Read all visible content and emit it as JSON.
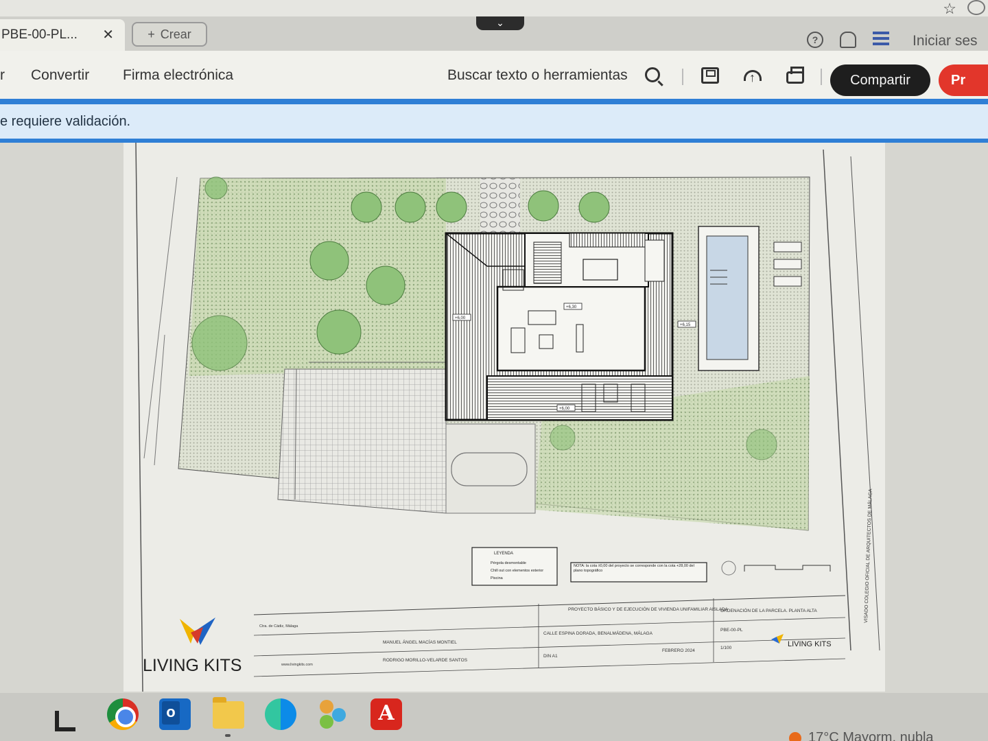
{
  "browser": {
    "tab_title": "PBE-00-PL...",
    "tab_close": "✕",
    "create_icon": "+",
    "create_label": "Crear",
    "collapse_icon": "⌄",
    "help_icon": "?",
    "signin_label": "Iniciar ses"
  },
  "toolbar": {
    "left_cut": "r",
    "convert_label": "Convertir",
    "esign_label": "Firma electrónica",
    "search_label": "Buscar texto o herramientas",
    "share_label": "Compartir",
    "red_button_label": "Pr"
  },
  "banner": {
    "text": "e requiere validación."
  },
  "document": {
    "legend_title": "LEYENDA",
    "legend_items": [
      "Pérgola desmontable",
      "Chill out con elementos exterior",
      "Piscina"
    ],
    "note": "NOTA: la cota ±0,00 del proyecto se corresponde con la cota +28,00 del plano topográfico",
    "level_tags": [
      "+6,00",
      "+6,30",
      "+6,15",
      "+6,00"
    ],
    "title_block": {
      "project": "PROYECTO BÁSICO Y DE EJECUCIÓN DE VIVIENDA UNIFAMILIAR AISLADA",
      "sheet_title": "ORDENACIÓN DE LA PARCELA. PLANTA ALTA",
      "location": "CALLE ESPINA DORADA, BENALMÁDENA, MÁLAGA",
      "sheet_number": "PBE-00-PL",
      "architect_1": "MANUEL ÁNGEL MACÍAS MONTIEL",
      "architect_2": "RODRIGO MORILLO-VELARDE SANTOS",
      "date": "FEBRERO 2024",
      "scale": "1/100",
      "format": "DIN A1",
      "company_small": "LIVING KITS",
      "company_address": "Ctra. de Cádiz, Málaga",
      "website": "www.livingkits.com",
      "side_label": "VISADO COLEGIO OFICIAL DE ARQUITECTOS DE MÁLAGA"
    },
    "brand": "LIVING KITS"
  },
  "taskbar": {
    "weather_text": "17°C  Mayorm. nubla"
  }
}
